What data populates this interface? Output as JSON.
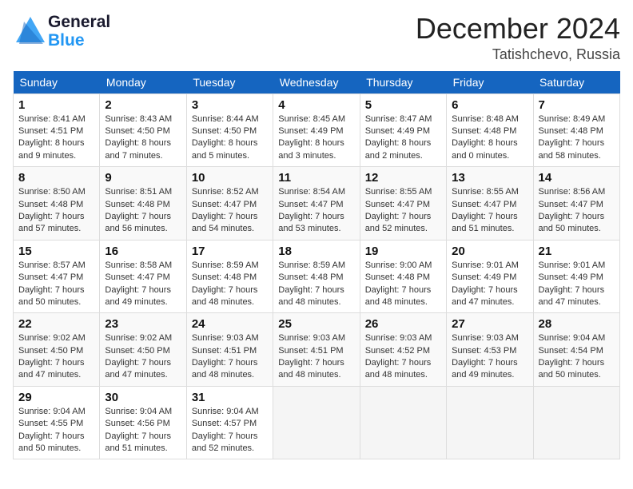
{
  "header": {
    "logo_line1": "General",
    "logo_line2": "Blue",
    "month": "December 2024",
    "location": "Tatishchevo, Russia"
  },
  "weekdays": [
    "Sunday",
    "Monday",
    "Tuesday",
    "Wednesday",
    "Thursday",
    "Friday",
    "Saturday"
  ],
  "weeks": [
    [
      {
        "day": "1",
        "sunrise": "Sunrise: 8:41 AM",
        "sunset": "Sunset: 4:51 PM",
        "daylight": "Daylight: 8 hours and 9 minutes."
      },
      {
        "day": "2",
        "sunrise": "Sunrise: 8:43 AM",
        "sunset": "Sunset: 4:50 PM",
        "daylight": "Daylight: 8 hours and 7 minutes."
      },
      {
        "day": "3",
        "sunrise": "Sunrise: 8:44 AM",
        "sunset": "Sunset: 4:50 PM",
        "daylight": "Daylight: 8 hours and 5 minutes."
      },
      {
        "day": "4",
        "sunrise": "Sunrise: 8:45 AM",
        "sunset": "Sunset: 4:49 PM",
        "daylight": "Daylight: 8 hours and 3 minutes."
      },
      {
        "day": "5",
        "sunrise": "Sunrise: 8:47 AM",
        "sunset": "Sunset: 4:49 PM",
        "daylight": "Daylight: 8 hours and 2 minutes."
      },
      {
        "day": "6",
        "sunrise": "Sunrise: 8:48 AM",
        "sunset": "Sunset: 4:48 PM",
        "daylight": "Daylight: 8 hours and 0 minutes."
      },
      {
        "day": "7",
        "sunrise": "Sunrise: 8:49 AM",
        "sunset": "Sunset: 4:48 PM",
        "daylight": "Daylight: 7 hours and 58 minutes."
      }
    ],
    [
      {
        "day": "8",
        "sunrise": "Sunrise: 8:50 AM",
        "sunset": "Sunset: 4:48 PM",
        "daylight": "Daylight: 7 hours and 57 minutes."
      },
      {
        "day": "9",
        "sunrise": "Sunrise: 8:51 AM",
        "sunset": "Sunset: 4:48 PM",
        "daylight": "Daylight: 7 hours and 56 minutes."
      },
      {
        "day": "10",
        "sunrise": "Sunrise: 8:52 AM",
        "sunset": "Sunset: 4:47 PM",
        "daylight": "Daylight: 7 hours and 54 minutes."
      },
      {
        "day": "11",
        "sunrise": "Sunrise: 8:54 AM",
        "sunset": "Sunset: 4:47 PM",
        "daylight": "Daylight: 7 hours and 53 minutes."
      },
      {
        "day": "12",
        "sunrise": "Sunrise: 8:55 AM",
        "sunset": "Sunset: 4:47 PM",
        "daylight": "Daylight: 7 hours and 52 minutes."
      },
      {
        "day": "13",
        "sunrise": "Sunrise: 8:55 AM",
        "sunset": "Sunset: 4:47 PM",
        "daylight": "Daylight: 7 hours and 51 minutes."
      },
      {
        "day": "14",
        "sunrise": "Sunrise: 8:56 AM",
        "sunset": "Sunset: 4:47 PM",
        "daylight": "Daylight: 7 hours and 50 minutes."
      }
    ],
    [
      {
        "day": "15",
        "sunrise": "Sunrise: 8:57 AM",
        "sunset": "Sunset: 4:47 PM",
        "daylight": "Daylight: 7 hours and 50 minutes."
      },
      {
        "day": "16",
        "sunrise": "Sunrise: 8:58 AM",
        "sunset": "Sunset: 4:47 PM",
        "daylight": "Daylight: 7 hours and 49 minutes."
      },
      {
        "day": "17",
        "sunrise": "Sunrise: 8:59 AM",
        "sunset": "Sunset: 4:48 PM",
        "daylight": "Daylight: 7 hours and 48 minutes."
      },
      {
        "day": "18",
        "sunrise": "Sunrise: 8:59 AM",
        "sunset": "Sunset: 4:48 PM",
        "daylight": "Daylight: 7 hours and 48 minutes."
      },
      {
        "day": "19",
        "sunrise": "Sunrise: 9:00 AM",
        "sunset": "Sunset: 4:48 PM",
        "daylight": "Daylight: 7 hours and 48 minutes."
      },
      {
        "day": "20",
        "sunrise": "Sunrise: 9:01 AM",
        "sunset": "Sunset: 4:49 PM",
        "daylight": "Daylight: 7 hours and 47 minutes."
      },
      {
        "day": "21",
        "sunrise": "Sunrise: 9:01 AM",
        "sunset": "Sunset: 4:49 PM",
        "daylight": "Daylight: 7 hours and 47 minutes."
      }
    ],
    [
      {
        "day": "22",
        "sunrise": "Sunrise: 9:02 AM",
        "sunset": "Sunset: 4:50 PM",
        "daylight": "Daylight: 7 hours and 47 minutes."
      },
      {
        "day": "23",
        "sunrise": "Sunrise: 9:02 AM",
        "sunset": "Sunset: 4:50 PM",
        "daylight": "Daylight: 7 hours and 47 minutes."
      },
      {
        "day": "24",
        "sunrise": "Sunrise: 9:03 AM",
        "sunset": "Sunset: 4:51 PM",
        "daylight": "Daylight: 7 hours and 48 minutes."
      },
      {
        "day": "25",
        "sunrise": "Sunrise: 9:03 AM",
        "sunset": "Sunset: 4:51 PM",
        "daylight": "Daylight: 7 hours and 48 minutes."
      },
      {
        "day": "26",
        "sunrise": "Sunrise: 9:03 AM",
        "sunset": "Sunset: 4:52 PM",
        "daylight": "Daylight: 7 hours and 48 minutes."
      },
      {
        "day": "27",
        "sunrise": "Sunrise: 9:03 AM",
        "sunset": "Sunset: 4:53 PM",
        "daylight": "Daylight: 7 hours and 49 minutes."
      },
      {
        "day": "28",
        "sunrise": "Sunrise: 9:04 AM",
        "sunset": "Sunset: 4:54 PM",
        "daylight": "Daylight: 7 hours and 50 minutes."
      }
    ],
    [
      {
        "day": "29",
        "sunrise": "Sunrise: 9:04 AM",
        "sunset": "Sunset: 4:55 PM",
        "daylight": "Daylight: 7 hours and 50 minutes."
      },
      {
        "day": "30",
        "sunrise": "Sunrise: 9:04 AM",
        "sunset": "Sunset: 4:56 PM",
        "daylight": "Daylight: 7 hours and 51 minutes."
      },
      {
        "day": "31",
        "sunrise": "Sunrise: 9:04 AM",
        "sunset": "Sunset: 4:57 PM",
        "daylight": "Daylight: 7 hours and 52 minutes."
      },
      null,
      null,
      null,
      null
    ]
  ]
}
